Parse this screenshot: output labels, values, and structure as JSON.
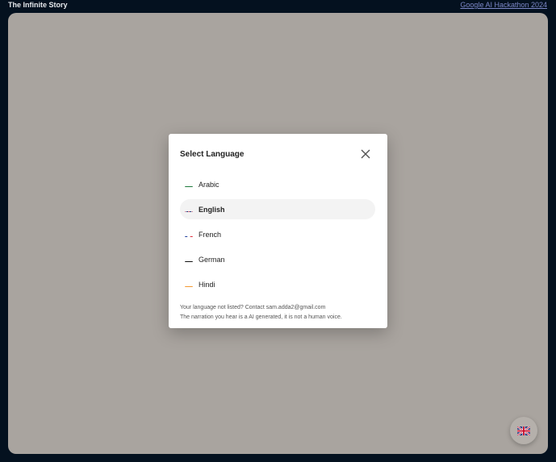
{
  "header": {
    "app_title": "The Infinite Story",
    "link_label": "Google AI Hackathon 2024"
  },
  "modal": {
    "title": "Select Language",
    "languages": [
      {
        "label": "Arabic",
        "flag": "sa-flag-icon",
        "selected": false
      },
      {
        "label": "English",
        "flag": "uk-flag-icon",
        "selected": true
      },
      {
        "label": "French",
        "flag": "fr-flag-icon",
        "selected": false
      },
      {
        "label": "German",
        "flag": "de-flag-icon",
        "selected": false
      },
      {
        "label": "Hindi",
        "flag": "in-flag-icon",
        "selected": false
      }
    ],
    "footnote_line1": "Your language not listed? Contact sam.adda2@gmail.com",
    "footnote_line2": "The narration you hear is a AI generated, it is not a human voice."
  },
  "colors": {
    "background": "#04111f",
    "stage": "#a9a49f",
    "link": "#7d88c8",
    "selected_item": "#f3f3f3"
  }
}
